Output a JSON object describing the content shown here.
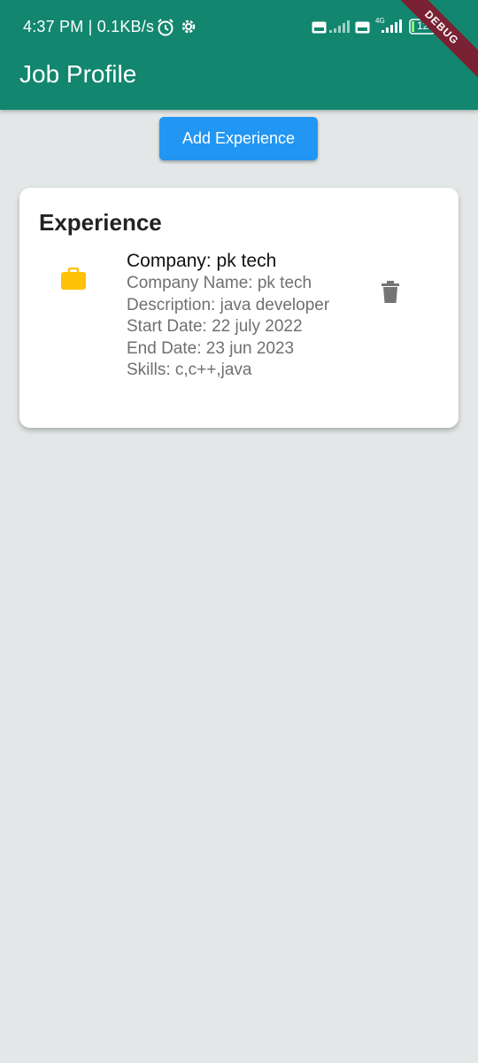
{
  "status_bar": {
    "time": "4:37 PM | 0.1KB/s",
    "icons": [
      "alarm-icon",
      "settings-icon",
      "volte-icon",
      "signal-icon",
      "volte-icon",
      "4g-signal-icon",
      "battery-icon"
    ],
    "battery_level": "12"
  },
  "debug_banner": "DEBUG",
  "app_bar": {
    "title": "Job Profile"
  },
  "actions": {
    "add_experience_label": "Add Experience"
  },
  "experience_card": {
    "title": "Experience",
    "entry": {
      "icon": "briefcase-icon",
      "heading": "Company: pk tech",
      "company_name": "Company Name: pk tech",
      "description": "Description: java developer",
      "start_date": "Start Date: 22 july 2022",
      "end_date": "End Date: 23 jun 2023",
      "skills": "Skills: c,c++,java"
    }
  },
  "colors": {
    "app_bar": "#12866f",
    "button": "#2196f3",
    "briefcase": "#ffc107",
    "background": "#e3e7e7"
  }
}
